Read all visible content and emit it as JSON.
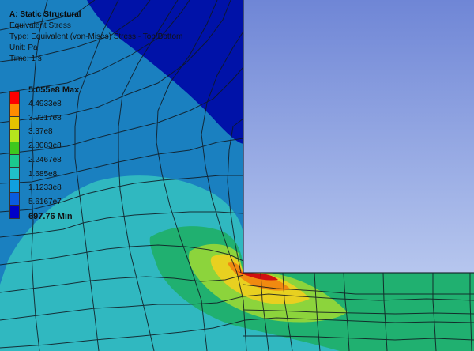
{
  "header": {
    "title": "A: Static Structural",
    "result_name": "Equivalent Stress",
    "type_line": "Type: Equivalent (von-Mises) Stress - Top/Bottom",
    "unit_line": "Unit: Pa",
    "time_line": "Time: 1 s"
  },
  "legend": {
    "max_label": "5.055e8 Max",
    "min_label": "697.76 Min",
    "levels": [
      "4.4933e8",
      "3.9317e8",
      "3.37e8",
      "2.8083e8",
      "2.2467e8",
      "1.685e8",
      "1.1233e8",
      "5.6167e7"
    ],
    "colors": [
      "#ff0000",
      "#ff8c00",
      "#e6c200",
      "#b5e61d",
      "#3ec81e",
      "#1bc98e",
      "#20c0c8",
      "#10a0e0",
      "#0a5ce0",
      "#0000c8"
    ]
  },
  "contour_colors": {
    "deep_blue": "#0012a8",
    "blue": "#1a80c0",
    "cyan": "#30b8c0",
    "green": "#20b070",
    "light_green": "#8cd43c",
    "yellow": "#e8d020",
    "orange": "#f08a10",
    "red": "#d01010",
    "background_top": "#6f86d6",
    "background_bottom": "#b6c6ee"
  }
}
